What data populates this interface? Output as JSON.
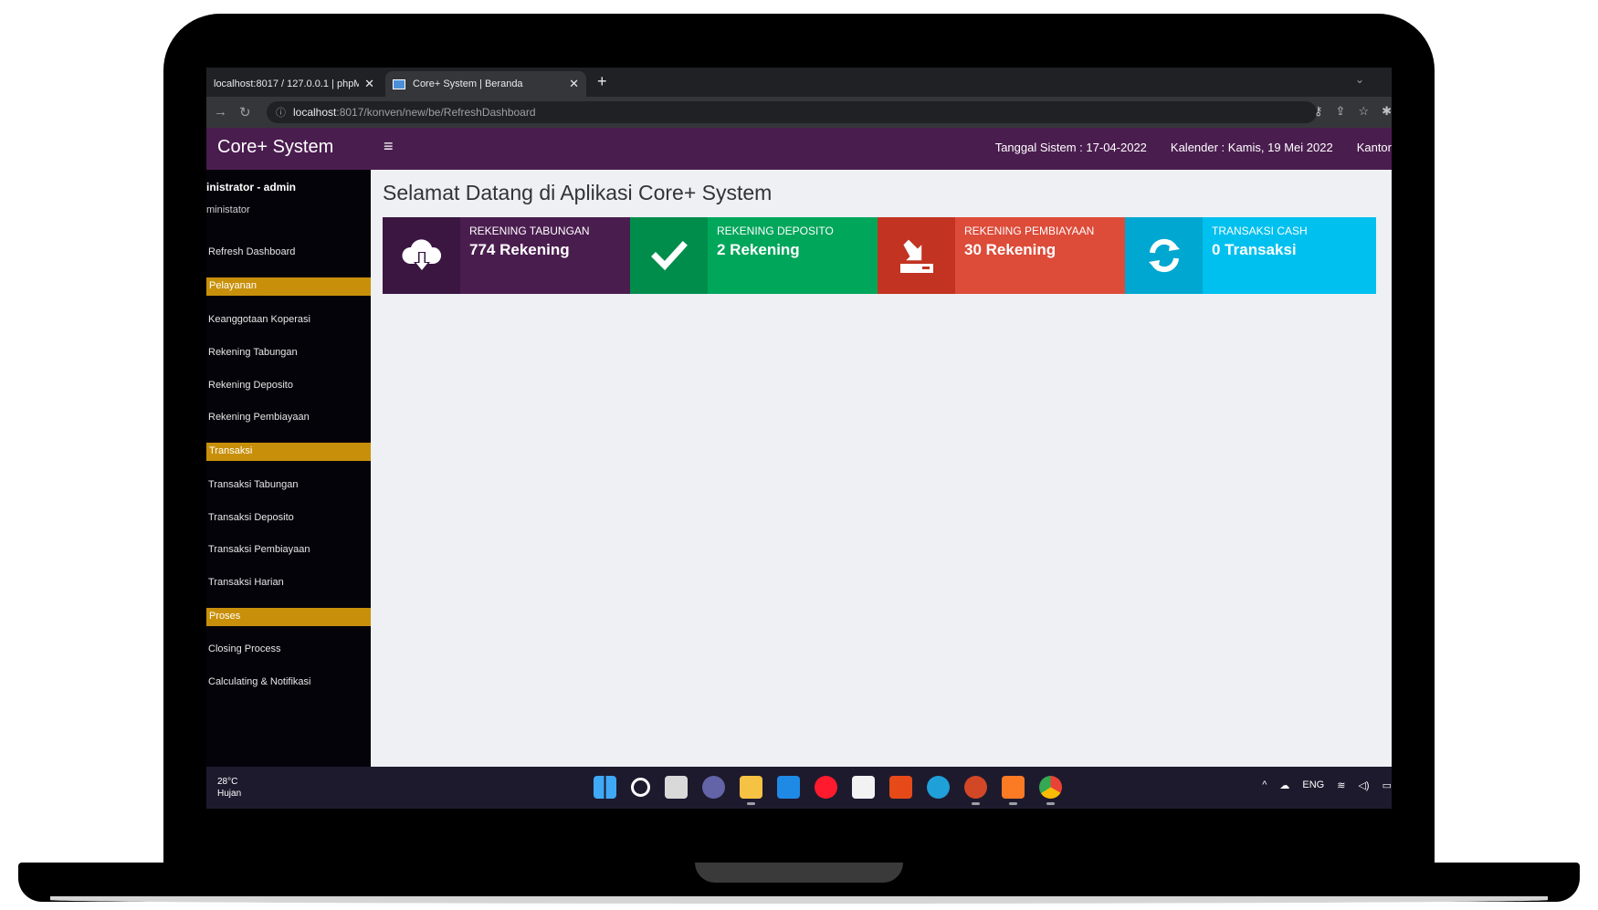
{
  "browser": {
    "tabs": [
      {
        "title": "localhost:8017 / 127.0.0.1 | phpM",
        "active": false
      },
      {
        "title": "Core+ System | Beranda",
        "active": true
      }
    ],
    "address_host": "localhost",
    "address_rest": ":8017/konven/new/be/RefreshDashboard"
  },
  "header": {
    "brand": "Core+ System",
    "tanggal_sistem": "Tanggal Sistem : 17-04-2022",
    "kalender": "Kalender : Kamis, 19 Mei 2022",
    "kantor": "Kantor"
  },
  "sidebar": {
    "user_name": "inistrator - admin",
    "user_role": "ministator",
    "refresh": "Refresh Dashboard",
    "sections": [
      {
        "title": "Pelayanan",
        "items": [
          "Keanggotaan Koperasi",
          "Rekening Tabungan",
          "Rekening Deposito",
          "Rekening Pembiayaan"
        ]
      },
      {
        "title": "Transaksi",
        "items": [
          "Transaksi Tabungan",
          "Transaksi Deposito",
          "Transaksi Pembiayaan",
          "Transaksi Harian"
        ]
      },
      {
        "title": "Proses",
        "items": [
          "Closing Process",
          "Calculating & Notifikasi"
        ]
      }
    ]
  },
  "main": {
    "welcome": "Selamat Datang di Aplikasi Core+ System",
    "cards": [
      {
        "label": "REKENING TABUNGAN",
        "value": "774 Rekening",
        "icon": "cloud-download-icon",
        "color": "#4a1d4f",
        "icon_bg": "#3a1640"
      },
      {
        "label": "REKENING DEPOSITO",
        "value": "2 Rekening",
        "icon": "check-icon",
        "color": "#00a65a",
        "icon_bg": "#008d4c"
      },
      {
        "label": "REKENING PEMBIAYAAN",
        "value": "30 Rekening",
        "icon": "download-tray-icon",
        "color": "#dd4b39",
        "icon_bg": "#c23321"
      },
      {
        "label": "TRANSAKSI CASH",
        "value": "0 Transaksi",
        "icon": "refresh-icon",
        "color": "#00c0ef",
        "icon_bg": "#00a7d0"
      }
    ]
  },
  "taskbar": {
    "weather_temp": "28°C",
    "weather_desc": "Hujan",
    "lang": "ENG"
  }
}
